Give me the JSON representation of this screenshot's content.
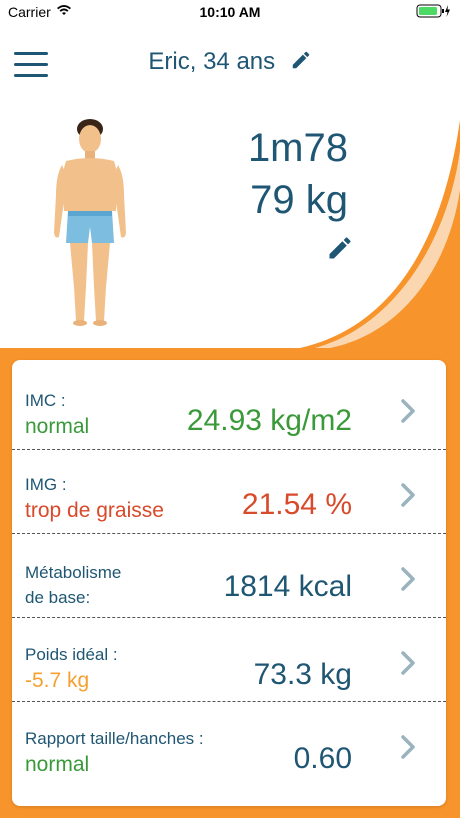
{
  "status_bar": {
    "carrier": "Carrier",
    "time": "10:10 AM"
  },
  "header": {
    "title": "Eric, 34 ans"
  },
  "profile": {
    "height": "1m78",
    "weight": "79 kg"
  },
  "results": [
    {
      "label": "IMC :",
      "status": "normal",
      "status_color": "#3a9a3a",
      "value": "24.93 kg/m2",
      "value_color": "#3a9a3a"
    },
    {
      "label": "IMG :",
      "status": "trop de graisse",
      "status_color": "#d84a2a",
      "value": "21.54 %",
      "value_color": "#d84a2a"
    },
    {
      "label": "Métabolisme",
      "label2": "de base:",
      "value": "1814 kcal",
      "value_color": "#1f5673"
    },
    {
      "label": "Poids idéal :",
      "status": "-5.7 kg",
      "status_color": "#f5a030",
      "value": "73.3 kg",
      "value_color": "#1f5673"
    },
    {
      "label": "Rapport taille/hanches :",
      "status": "normal",
      "status_color": "#3a9a3a",
      "value": "0.60",
      "value_color": "#1f5673"
    }
  ],
  "colors": {
    "accent_orange": "#f7942b",
    "primary_blue": "#1f5673",
    "chevron_gray": "#9ab3bd"
  }
}
